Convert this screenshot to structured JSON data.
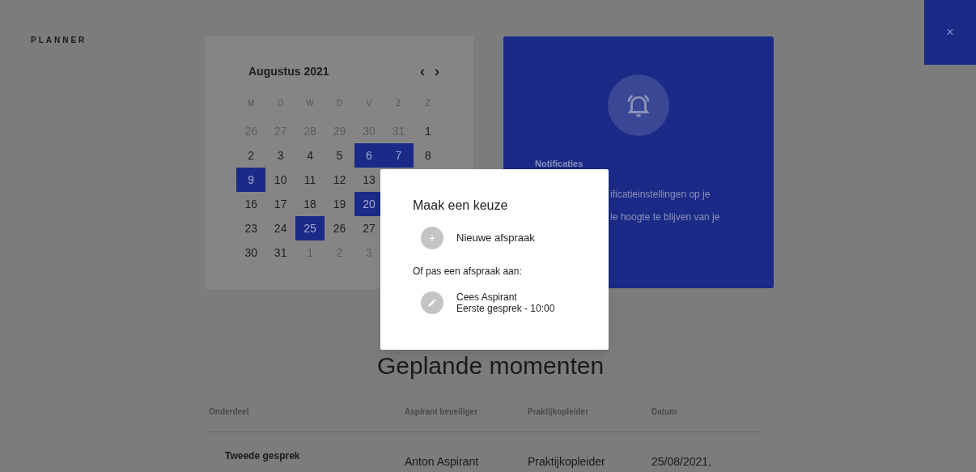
{
  "app_title": "PLANNER",
  "calendar": {
    "month": "Augustus 2021",
    "prev": "‹",
    "next": "›",
    "weekdays": [
      "M",
      "D",
      "W",
      "D",
      "V",
      "Z",
      "Z"
    ],
    "weeks": [
      [
        {
          "label": "26",
          "selected": false,
          "muted": true
        },
        {
          "label": "27",
          "selected": false,
          "muted": true
        },
        {
          "label": "28",
          "selected": false,
          "muted": true
        },
        {
          "label": "29",
          "selected": false,
          "muted": true
        },
        {
          "label": "30",
          "selected": false,
          "muted": true
        },
        {
          "label": "31",
          "selected": false,
          "muted": true
        },
        {
          "label": "1",
          "selected": false,
          "muted": false
        }
      ],
      [
        {
          "label": "2",
          "selected": false,
          "muted": false
        },
        {
          "label": "3",
          "selected": false,
          "muted": false
        },
        {
          "label": "4",
          "selected": false,
          "muted": false
        },
        {
          "label": "5",
          "selected": false,
          "muted": false
        },
        {
          "label": "6",
          "selected": true,
          "muted": false
        },
        {
          "label": "7",
          "selected": true,
          "muted": false
        },
        {
          "label": "8",
          "selected": false,
          "muted": false
        }
      ],
      [
        {
          "label": "9",
          "selected": true,
          "muted": false
        },
        {
          "label": "10",
          "selected": false,
          "muted": false
        },
        {
          "label": "11",
          "selected": false,
          "muted": false
        },
        {
          "label": "12",
          "selected": false,
          "muted": false
        },
        {
          "label": "13",
          "selected": false,
          "muted": false
        }
      ],
      [
        {
          "label": "16",
          "selected": false,
          "muted": false
        },
        {
          "label": "17",
          "selected": false,
          "muted": false
        },
        {
          "label": "18",
          "selected": false,
          "muted": false
        },
        {
          "label": "19",
          "selected": false,
          "muted": false
        },
        {
          "label": "20",
          "selected": true,
          "muted": false
        }
      ],
      [
        {
          "label": "23",
          "selected": false,
          "muted": false
        },
        {
          "label": "24",
          "selected": false,
          "muted": false
        },
        {
          "label": "25",
          "selected": true,
          "muted": false
        },
        {
          "label": "26",
          "selected": false,
          "muted": false
        },
        {
          "label": "27",
          "selected": false,
          "muted": false
        }
      ],
      [
        {
          "label": "30",
          "selected": false,
          "muted": false
        },
        {
          "label": "31",
          "selected": false,
          "muted": false
        },
        {
          "label": "1",
          "selected": false,
          "muted": true
        },
        {
          "label": "2",
          "selected": false,
          "muted": true
        },
        {
          "label": "3",
          "selected": false,
          "muted": true
        }
      ]
    ]
  },
  "notifications": {
    "title": "Notificaties",
    "lines": [
      "ificatieinstellingen op je",
      "le hoogte te blijven van je"
    ]
  },
  "close": "×",
  "modal": {
    "title": "Maak een keuze",
    "new_label": "Nieuwe afspraak",
    "plus": "+",
    "subtitle": "Of pas een afspraak aan:",
    "appointments": [
      {
        "name": "Cees Aspirant",
        "detail": "Eerste gesprek - 10:00"
      }
    ]
  },
  "planned": {
    "title": "Geplande momenten",
    "columns": [
      "Onderdeel",
      "Aspirant beveiliger",
      "Praktijkopleider",
      "Datum"
    ],
    "rows": [
      [
        "Tweede gesprek",
        "Anton Aspirant",
        "Praktijkopleider",
        "25/08/2021,"
      ]
    ]
  }
}
